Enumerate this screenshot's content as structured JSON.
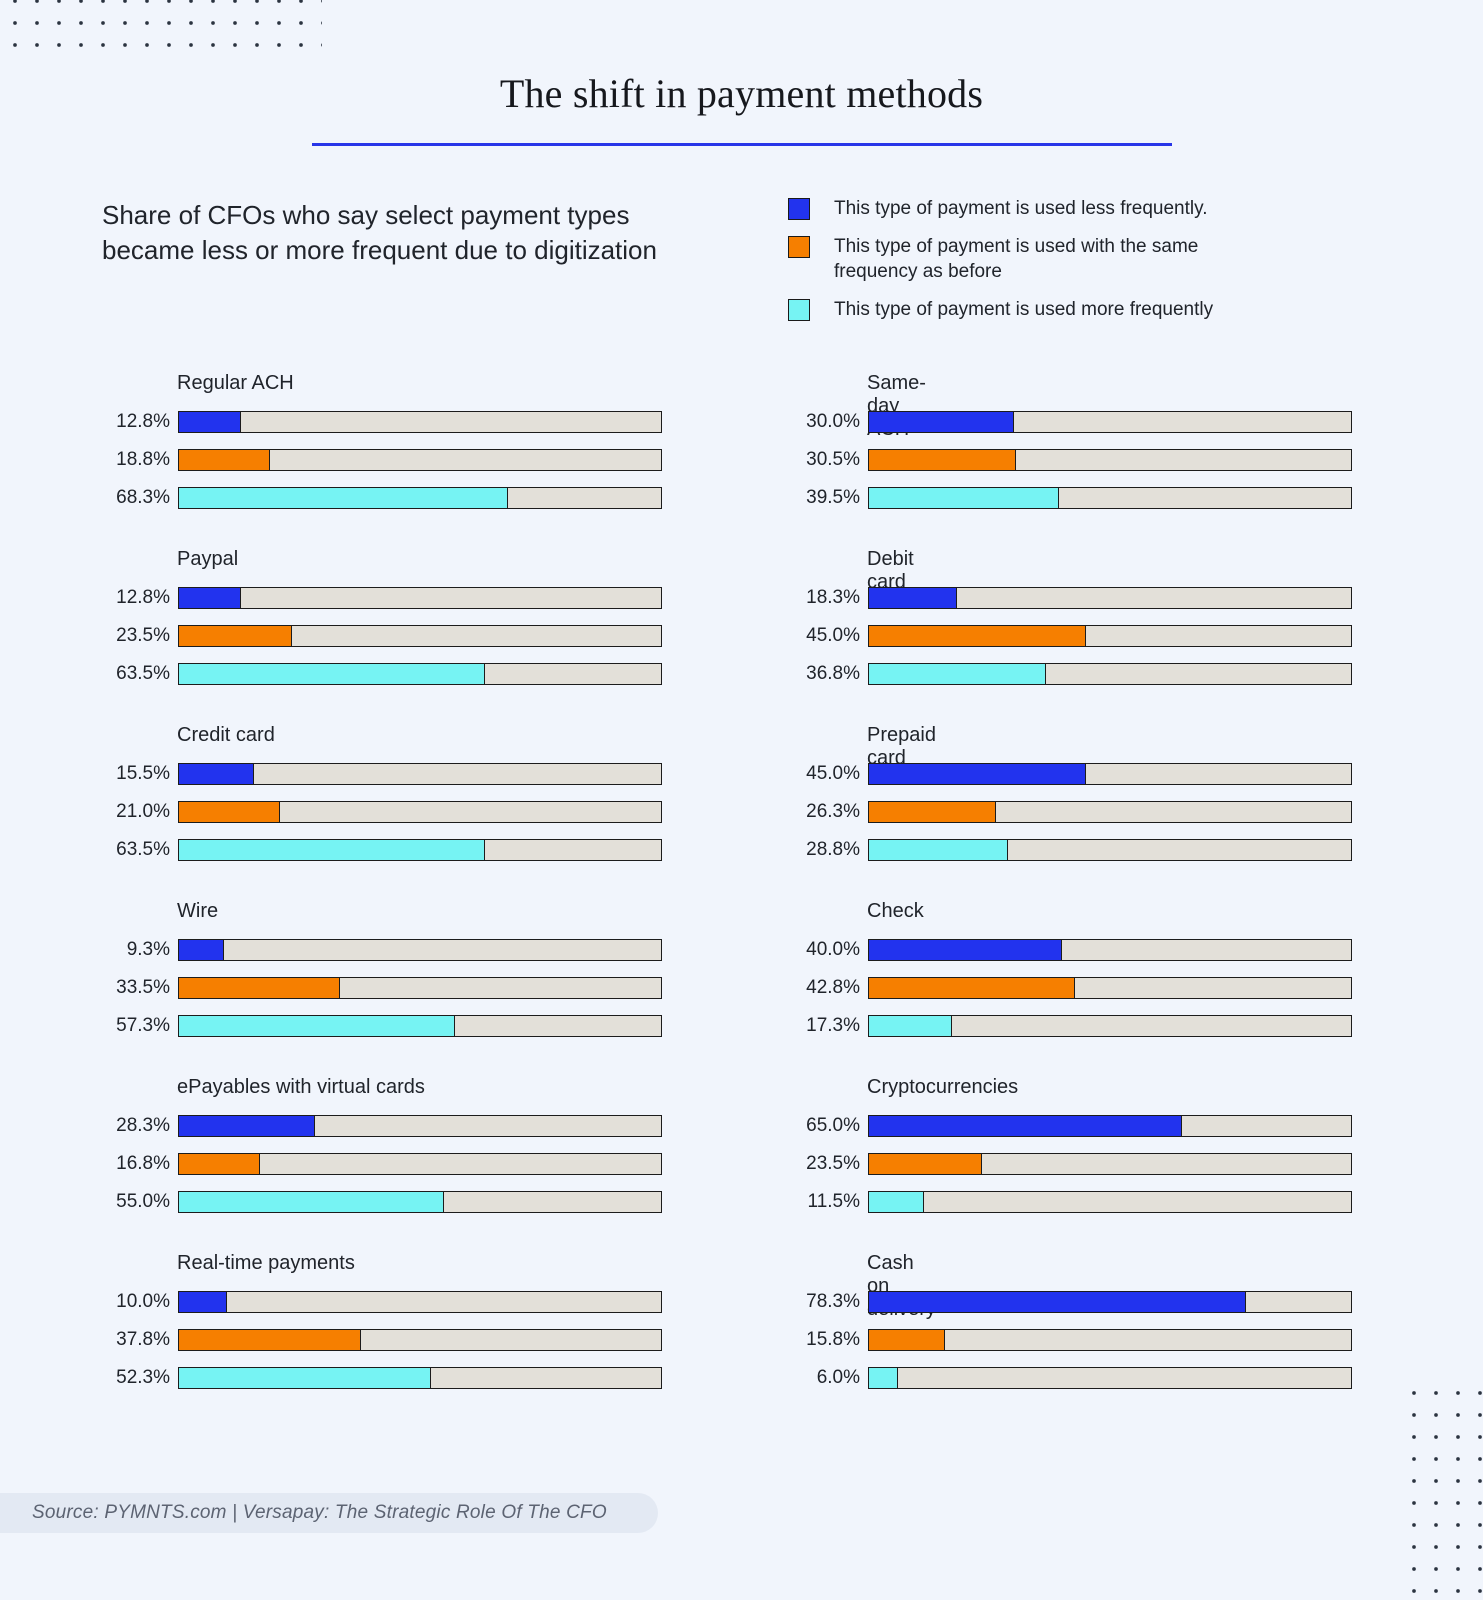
{
  "header": {
    "title": "The shift in payment methods",
    "rule_color": "#2735e8"
  },
  "subtitle": "Share of CFOs who say select payment types became less or more frequent due to digitization",
  "legend": {
    "items": [
      {
        "label": "This type of payment is used less frequently.",
        "color": "#2233ee",
        "key": "less"
      },
      {
        "label": "This type of payment is used with the same frequency as before",
        "color": "#f67f00",
        "key": "same"
      },
      {
        "label": "This type of payment is used more frequently",
        "color": "#76f3f3",
        "key": "more"
      }
    ]
  },
  "source": "Source: PYMNTS.com | Versapay: The Strategic Role Of The CFO",
  "chart_data": {
    "type": "bar",
    "title": "The shift in payment methods",
    "subtitle": "Share of CFOs who say select payment types became less or more frequent due to digitization",
    "xlabel": "",
    "ylabel": "",
    "xlim": [
      0,
      100
    ],
    "grid": false,
    "legend_position": "top-right",
    "value_format": "percent",
    "series": [
      {
        "name": "This type of payment is used less frequently.",
        "color": "#2233ee"
      },
      {
        "name": "This type of payment is used with the same frequency as before",
        "color": "#f67f00"
      },
      {
        "name": "This type of payment is used more frequently",
        "color": "#76f3f3"
      }
    ],
    "categories": [
      "Regular ACH",
      "Same-day ACH",
      "Paypal",
      "Debit card",
      "Credit card",
      "Prepaid card",
      "Wire",
      "Check",
      "ePayables with virtual cards",
      "Cryptocurrencies",
      "Real-time payments",
      "Cash on delivery"
    ],
    "groups": [
      {
        "label": "Regular ACH",
        "column": "left",
        "bars": [
          {
            "series": "less",
            "value": 12.8,
            "label": "12.8%"
          },
          {
            "series": "same",
            "value": 18.8,
            "label": "18.8%"
          },
          {
            "series": "more",
            "value": 68.3,
            "label": "68.3%"
          }
        ]
      },
      {
        "label": "Same-day ACH",
        "column": "right",
        "bars": [
          {
            "series": "less",
            "value": 30.0,
            "label": "30.0%"
          },
          {
            "series": "same",
            "value": 30.5,
            "label": "30.5%"
          },
          {
            "series": "more",
            "value": 39.5,
            "label": "39.5%"
          }
        ]
      },
      {
        "label": "Paypal",
        "column": "left",
        "bars": [
          {
            "series": "less",
            "value": 12.8,
            "label": "12.8%"
          },
          {
            "series": "same",
            "value": 23.5,
            "label": "23.5%"
          },
          {
            "series": "more",
            "value": 63.5,
            "label": "63.5%"
          }
        ]
      },
      {
        "label": "Debit card",
        "column": "right",
        "bars": [
          {
            "series": "less",
            "value": 18.3,
            "label": "18.3%"
          },
          {
            "series": "same",
            "value": 45.0,
            "label": "45.0%"
          },
          {
            "series": "more",
            "value": 36.8,
            "label": "36.8%"
          }
        ]
      },
      {
        "label": "Credit card",
        "column": "left",
        "bars": [
          {
            "series": "less",
            "value": 15.5,
            "label": "15.5%"
          },
          {
            "series": "same",
            "value": 21.0,
            "label": "21.0%"
          },
          {
            "series": "more",
            "value": 63.5,
            "label": "63.5%"
          }
        ]
      },
      {
        "label": "Prepaid card",
        "column": "right",
        "bars": [
          {
            "series": "less",
            "value": 45.0,
            "label": "45.0%"
          },
          {
            "series": "same",
            "value": 26.3,
            "label": "26.3%"
          },
          {
            "series": "more",
            "value": 28.8,
            "label": "28.8%"
          }
        ]
      },
      {
        "label": "Wire",
        "column": "left",
        "bars": [
          {
            "series": "less",
            "value": 9.3,
            "label": "9.3%"
          },
          {
            "series": "same",
            "value": 33.5,
            "label": "33.5%"
          },
          {
            "series": "more",
            "value": 57.3,
            "label": "57.3%"
          }
        ]
      },
      {
        "label": "Check",
        "column": "right",
        "bars": [
          {
            "series": "less",
            "value": 40.0,
            "label": "40.0%"
          },
          {
            "series": "same",
            "value": 42.8,
            "label": "42.8%"
          },
          {
            "series": "more",
            "value": 17.3,
            "label": "17.3%"
          }
        ]
      },
      {
        "label": "ePayables with virtual cards",
        "column": "left",
        "bars": [
          {
            "series": "less",
            "value": 28.3,
            "label": "28.3%"
          },
          {
            "series": "same",
            "value": 16.8,
            "label": "16.8%"
          },
          {
            "series": "more",
            "value": 55.0,
            "label": "55.0%"
          }
        ]
      },
      {
        "label": "Cryptocurrencies",
        "column": "right",
        "bars": [
          {
            "series": "less",
            "value": 65.0,
            "label": "65.0%"
          },
          {
            "series": "same",
            "value": 23.5,
            "label": "23.5%"
          },
          {
            "series": "more",
            "value": 11.5,
            "label": "11.5%"
          }
        ]
      },
      {
        "label": "Real-time payments",
        "column": "left",
        "bars": [
          {
            "series": "less",
            "value": 10.0,
            "label": "10.0%"
          },
          {
            "series": "same",
            "value": 37.8,
            "label": "37.8%"
          },
          {
            "series": "more",
            "value": 52.3,
            "label": "52.3%"
          }
        ]
      },
      {
        "label": "Cash on delivery",
        "column": "right",
        "bars": [
          {
            "series": "less",
            "value": 78.3,
            "label": "78.3%"
          },
          {
            "series": "same",
            "value": 15.8,
            "label": "15.8%"
          },
          {
            "series": "more",
            "value": 6.0,
            "label": "6.0%"
          }
        ]
      }
    ]
  }
}
